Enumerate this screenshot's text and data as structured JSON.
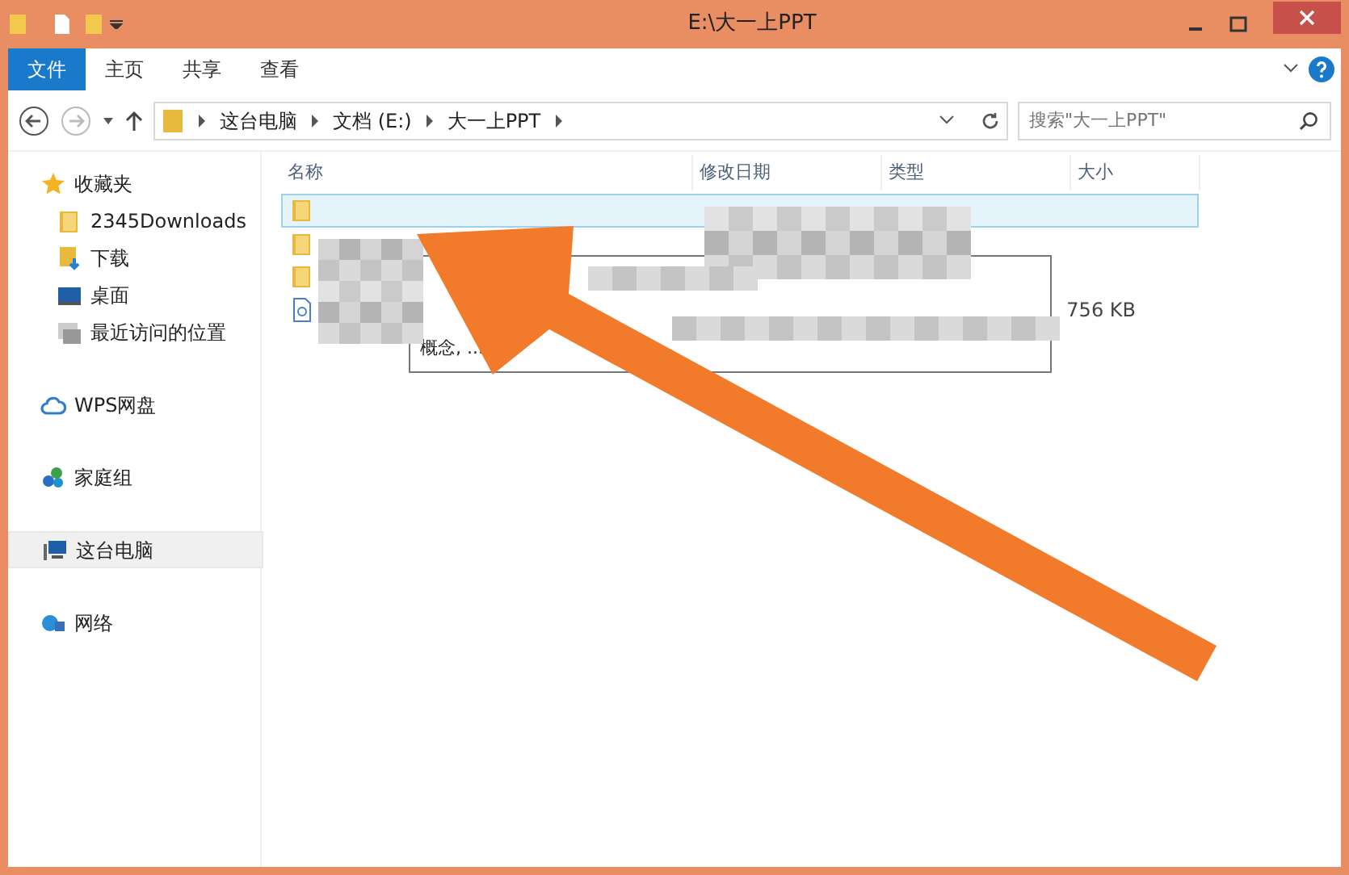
{
  "window": {
    "title": "E:\\大一上PPT"
  },
  "ribbon_tabs": [
    {
      "label": "文件",
      "kind": "file"
    },
    {
      "label": "主页",
      "kind": "tab"
    },
    {
      "label": "共享",
      "kind": "tab"
    },
    {
      "label": "查看",
      "kind": "tab"
    }
  ],
  "address_bar": {
    "breadcrumbs": [
      "这台电脑",
      "文档 (E:)",
      "大一上PPT"
    ]
  },
  "search": {
    "placeholder": "搜索\"大一上PPT\""
  },
  "sidebar": [
    {
      "label": "收藏夹",
      "kind": "star",
      "selected": false,
      "children": [
        {
          "label": "2345Downloads",
          "kind": "folder",
          "selected": false
        },
        {
          "label": "下载",
          "kind": "download",
          "selected": false
        },
        {
          "label": "桌面",
          "kind": "desktop",
          "selected": false
        },
        {
          "label": "最近访问的位置",
          "kind": "recent",
          "selected": false
        }
      ]
    },
    {
      "label": "WPS网盘",
      "kind": "cloud",
      "selected": false
    },
    {
      "label": "家庭组",
      "kind": "homegroup",
      "selected": false
    },
    {
      "label": "这台电脑",
      "kind": "computer",
      "selected": true
    },
    {
      "label": "网络",
      "kind": "network",
      "selected": false
    }
  ],
  "table": {
    "columns": [
      "名称",
      "修改日期",
      "类型",
      "大小"
    ],
    "rows": [
      {
        "kind": "folder",
        "selected": true
      },
      {
        "kind": "folder",
        "selected": false
      },
      {
        "kind": "folder",
        "selected": false
      },
      {
        "kind": "document",
        "selected": false,
        "size": "756 KB"
      }
    ]
  },
  "tooltip": {
    "text": "概念, ..."
  }
}
